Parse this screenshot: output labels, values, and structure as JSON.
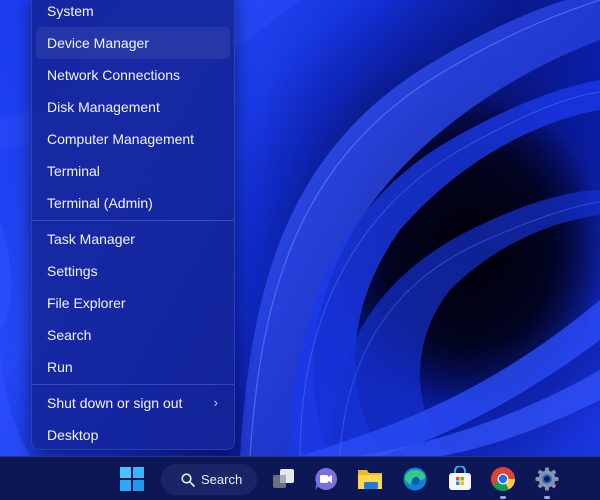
{
  "menu": {
    "groups": [
      [
        {
          "label": "System"
        },
        {
          "label": "Device Manager",
          "highlighted": true
        },
        {
          "label": "Network Connections"
        },
        {
          "label": "Disk Management"
        },
        {
          "label": "Computer Management"
        },
        {
          "label": "Terminal"
        },
        {
          "label": "Terminal (Admin)"
        }
      ],
      [
        {
          "label": "Task Manager"
        },
        {
          "label": "Settings"
        },
        {
          "label": "File Explorer"
        },
        {
          "label": "Search"
        },
        {
          "label": "Run"
        }
      ],
      [
        {
          "label": "Shut down or sign out",
          "submenu": true,
          "chevron": "›"
        },
        {
          "label": "Desktop"
        }
      ]
    ]
  },
  "taskbar": {
    "search_label": "Search",
    "icons": [
      {
        "name": "start-icon"
      },
      {
        "name": "task-view-icon"
      },
      {
        "name": "teams-chat-icon"
      },
      {
        "name": "file-explorer-icon"
      },
      {
        "name": "edge-icon"
      },
      {
        "name": "microsoft-store-icon"
      },
      {
        "name": "chrome-icon",
        "running": true
      },
      {
        "name": "settings-icon",
        "running": true
      }
    ]
  },
  "colors": {
    "menu_bg": "#1424a0",
    "taskbar_bg": "#0e1755",
    "text": "#f2f4ff",
    "wallpaper_accent": "#1a3cf0"
  }
}
